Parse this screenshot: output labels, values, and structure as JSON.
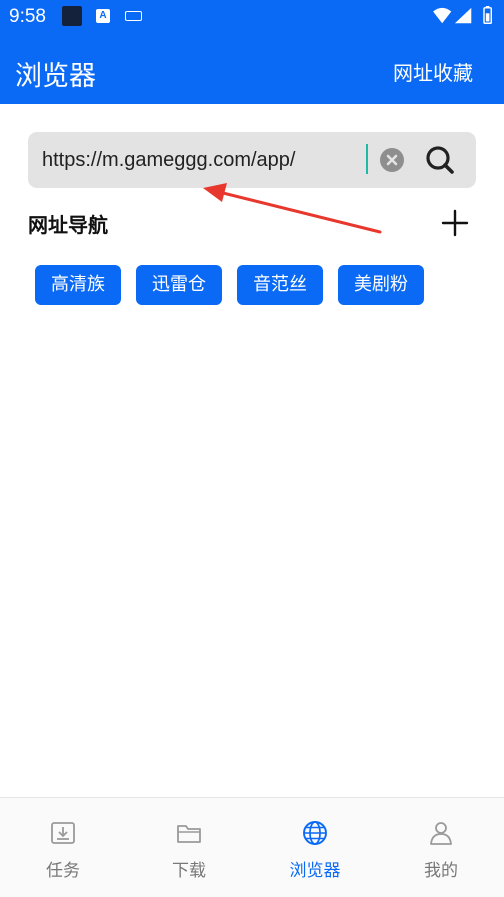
{
  "status_bar": {
    "time": "9:58",
    "app_icon_letter": "A",
    "icons": [
      "notification-square-icon",
      "a-app-icon",
      "keyboard-icon",
      "wifi-icon",
      "signal-icon",
      "battery-icon"
    ]
  },
  "header": {
    "title": "浏览器",
    "favorites_label": "网址收藏",
    "background_color": "#0a6af5"
  },
  "search": {
    "value": "https://m.gameggg.com/app/",
    "clear_icon": "clear-icon",
    "search_icon": "search-icon"
  },
  "navigation": {
    "title": "网址导航",
    "add_icon": "plus-icon",
    "chips": [
      {
        "label": "高清族"
      },
      {
        "label": "迅雷仓"
      },
      {
        "label": "音范丝"
      },
      {
        "label": "美剧粉"
      }
    ]
  },
  "annotation": {
    "arrow_color": "#e8382d"
  },
  "bottom_nav": {
    "tabs": [
      {
        "label": "任务",
        "icon": "download-tray-icon",
        "active": false
      },
      {
        "label": "下载",
        "icon": "folder-icon",
        "active": false
      },
      {
        "label": "浏览器",
        "icon": "globe-icon",
        "active": true
      },
      {
        "label": "我的",
        "icon": "person-icon",
        "active": false
      }
    ]
  },
  "colors": {
    "primary": "#0a6af5",
    "inactive_tab": "#777777",
    "search_bg": "#e3e3e3"
  }
}
